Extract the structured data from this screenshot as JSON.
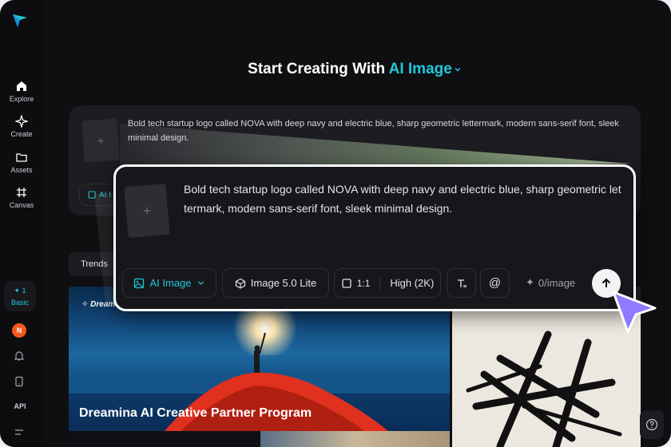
{
  "sidebar": {
    "items": [
      {
        "label": "Explore",
        "icon": "home-icon"
      },
      {
        "label": "Create",
        "icon": "sparkle-icon"
      },
      {
        "label": "Assets",
        "icon": "folder-icon"
      },
      {
        "label": "Canvas",
        "icon": "canvas-icon"
      }
    ],
    "credits": {
      "count": "1",
      "plan": "Basic"
    },
    "avatar_initial": "N",
    "api_label": "API"
  },
  "header": {
    "prefix": "Start Creating With",
    "mode": "AI Image"
  },
  "prompt_text": "Bold tech startup logo called NOVA with deep navy and electric blue, sharp geometric lettermark, modern sans-serif font, sleek minimal design.",
  "prompt_small_text": "Bold tech startup logo called NOVA with deep navy and electric blue, sharp geometric lettermark, modern sans-serif font, sleek minimal design.",
  "small_tool_label": "AI I",
  "toolbar": {
    "mode_label": "AI Image",
    "model_label": "Image 5.0 Lite",
    "ratio_label": "1:1",
    "quality_label": "High (2K)",
    "cost_label": "0/image"
  },
  "tabs": {
    "trends": "Trends"
  },
  "gallery": {
    "brand": "Dreamina",
    "caption": "Dreamina AI Creative Partner Program"
  },
  "colors": {
    "accent": "#21c8d8",
    "background": "#0f0f12",
    "cursor": "#8f7bff"
  }
}
